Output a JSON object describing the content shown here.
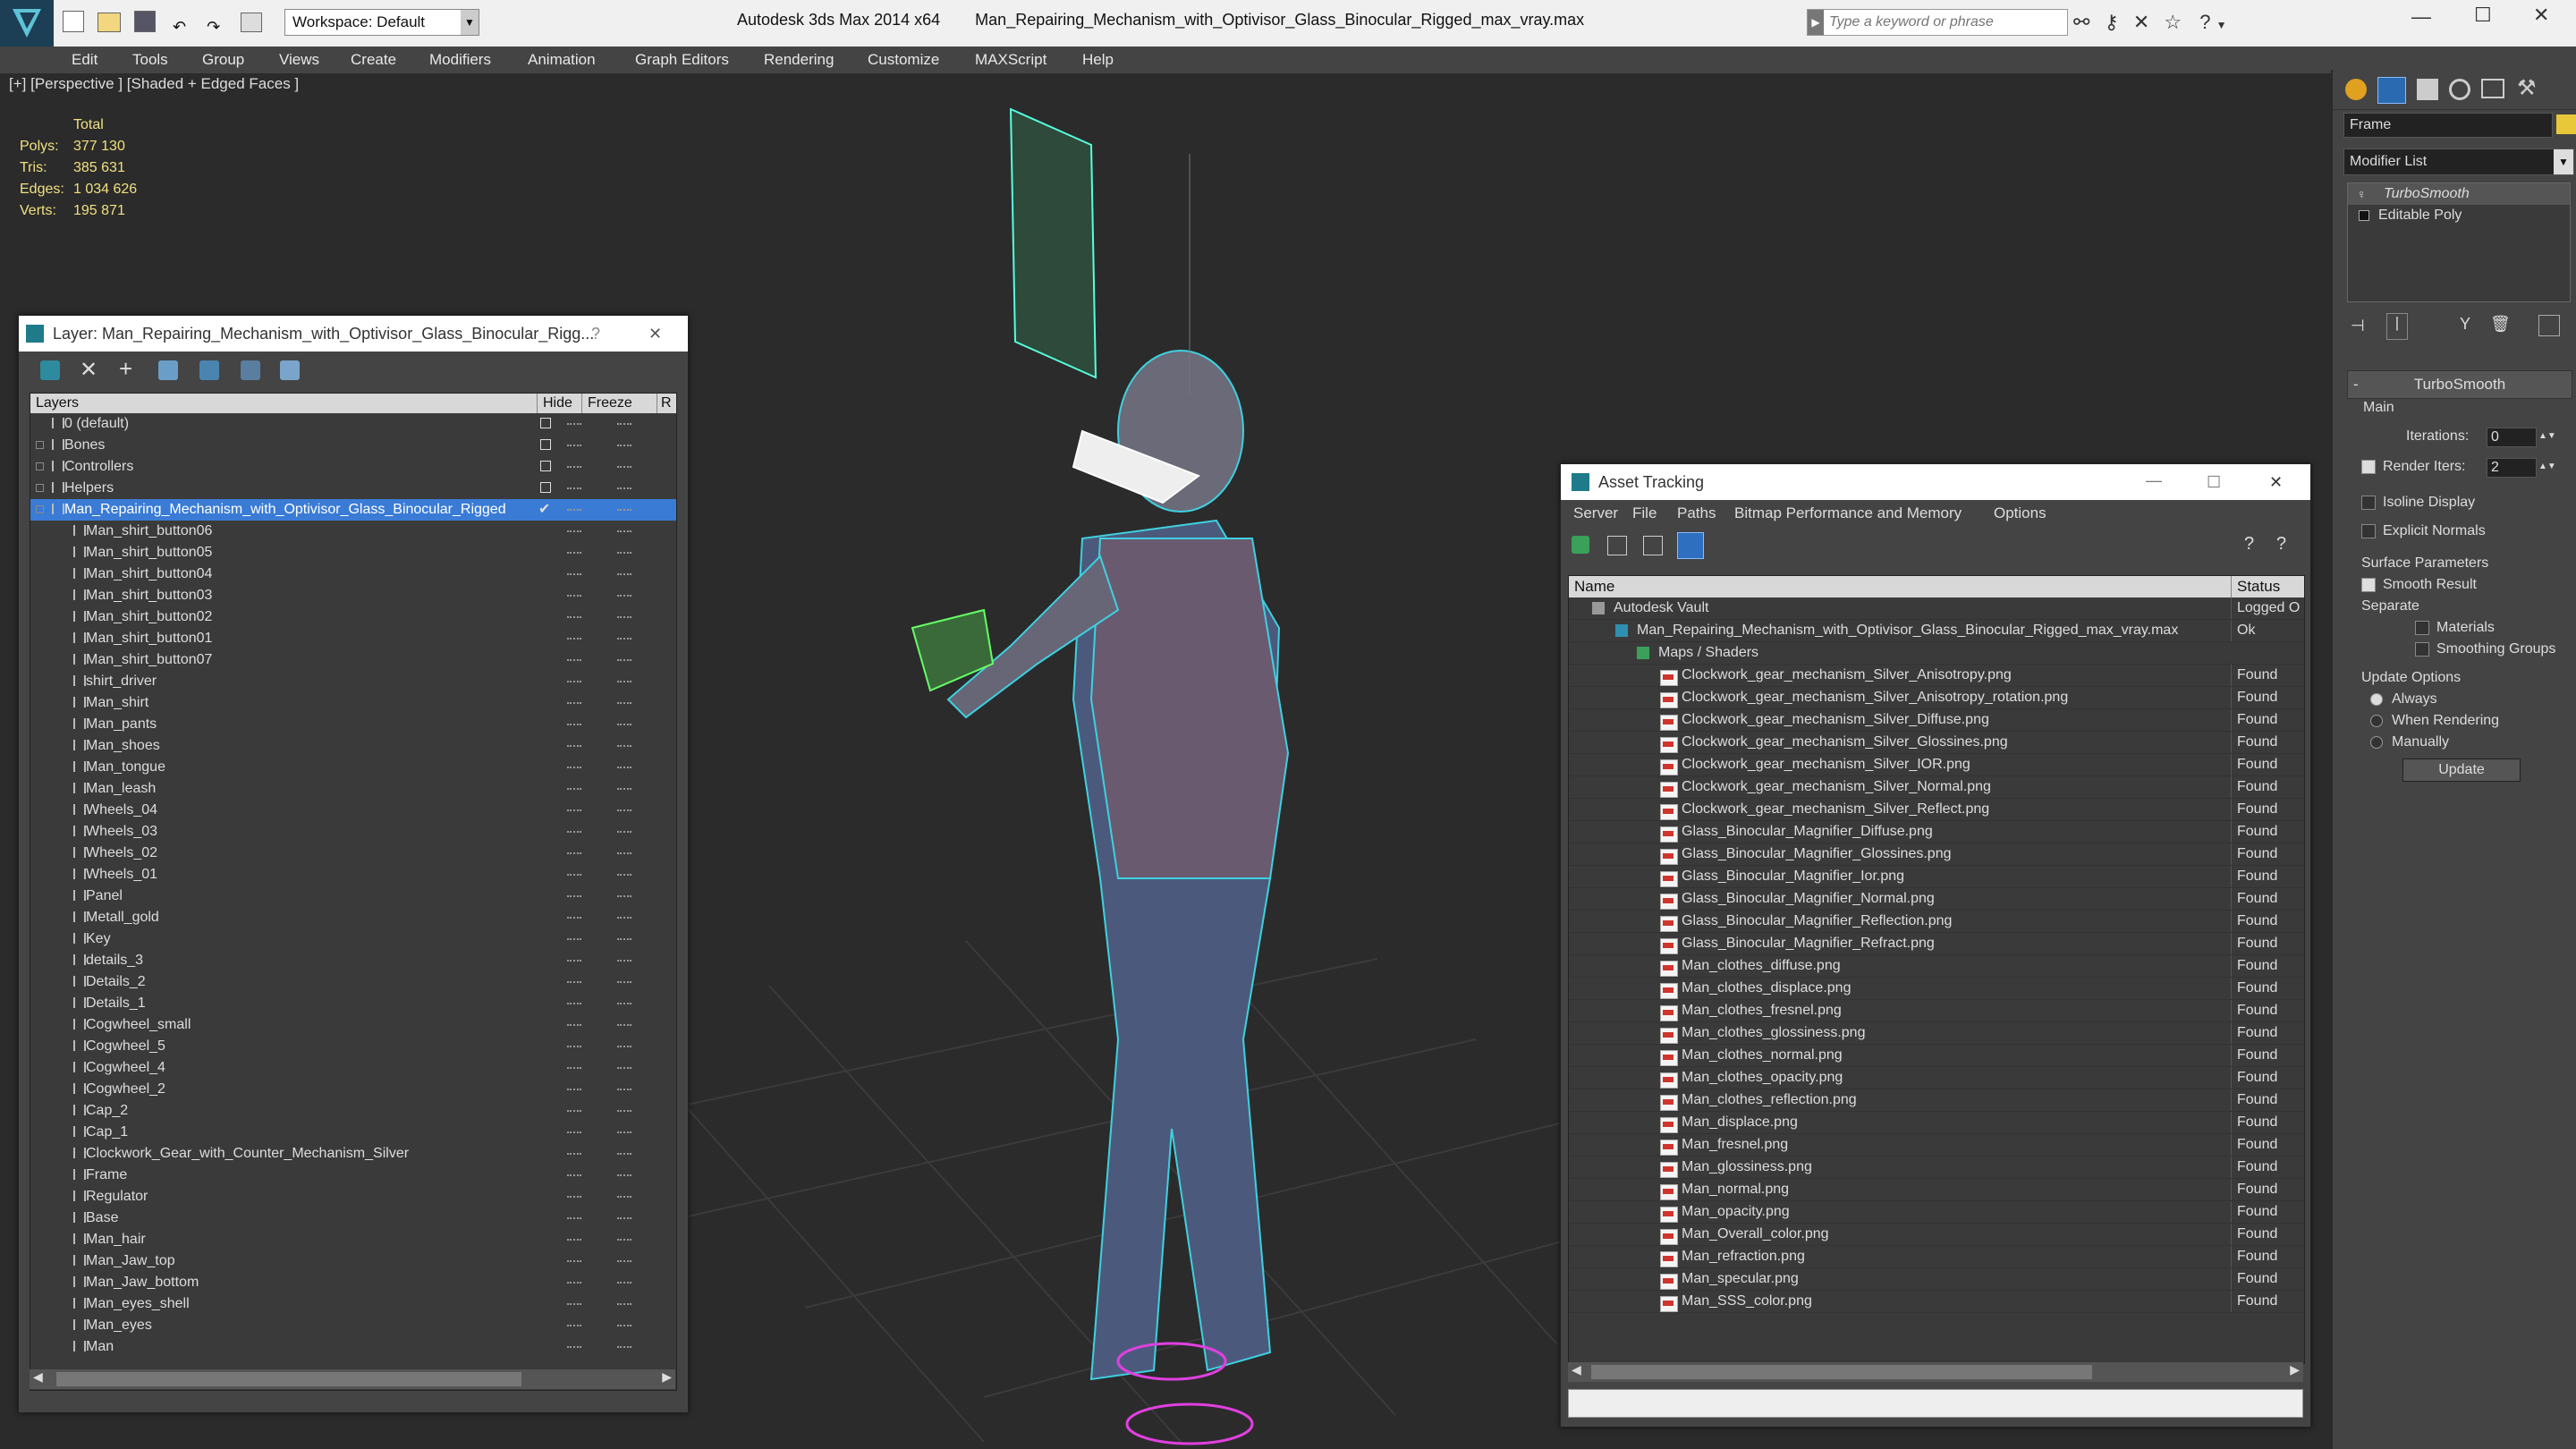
{
  "app": {
    "title": "Autodesk 3ds Max  2014 x64",
    "file": "Man_Repairing_Mechanism_with_Optivisor_Glass_Binocular_Rigged_max_vray.max",
    "workspace": "Workspace: Default",
    "search_placeholder": "Type a keyword or phrase"
  },
  "menu": [
    "Edit",
    "Tools",
    "Group",
    "Views",
    "Create",
    "Modifiers",
    "Animation",
    "Graph Editors",
    "Rendering",
    "Customize",
    "MAXScript",
    "Help"
  ],
  "viewport": {
    "label": "[+] [Perspective ] [Shaded + Edged Faces ]",
    "stats": {
      "total_label": "Total",
      "rows": [
        {
          "label": "Polys:",
          "value": "377 130"
        },
        {
          "label": "Tris:",
          "value": "385 631"
        },
        {
          "label": "Edges:",
          "value": "1 034 626"
        },
        {
          "label": "Verts:",
          "value": "195 871"
        }
      ]
    }
  },
  "layer_window": {
    "title": "Layer: Man_Repairing_Mechanism_with_Optivisor_Glass_Binocular_Rigg...",
    "help": "?",
    "close": "✕",
    "col_layers": "Layers",
    "col_hide": "Hide",
    "col_freeze": "Freeze",
    "col_r": "R",
    "top_layers": [
      "0 (default)",
      "Bones",
      "Controllers",
      "Helpers"
    ],
    "selected_layer": "Man_Repairing_Mechanism_with_Optivisor_Glass_Binocular_Rigged",
    "objects": [
      "Man_shirt_button06",
      "Man_shirt_button05",
      "Man_shirt_button04",
      "Man_shirt_button03",
      "Man_shirt_button02",
      "Man_shirt_button01",
      "Man_shirt_button07",
      "shirt_driver",
      "Man_shirt",
      "Man_pants",
      "Man_shoes",
      "Man_tongue",
      "Man_leash",
      "Wheels_04",
      "Wheels_03",
      "Wheels_02",
      "Wheels_01",
      "Panel",
      "Metall_gold",
      "Key",
      "details_3",
      "Details_2",
      "Details_1",
      "Cogwheel_small",
      "Cogwheel_5",
      "Cogwheel_4",
      "Cogwheel_2",
      "Cap_2",
      "Cap_1",
      "Clockwork_Gear_with_Counter_Mechanism_Silver",
      "Frame",
      "Regulator",
      "Base",
      "Man_hair",
      "Man_Jaw_top",
      "Man_Jaw_bottom",
      "Man_eyes_shell",
      "Man_eyes",
      "Man"
    ]
  },
  "asset_window": {
    "title": "Asset Tracking",
    "menu": [
      "Server",
      "File",
      "Paths",
      "Bitmap Performance and Memory",
      "Options"
    ],
    "col_name": "Name",
    "col_status": "Status",
    "vault": {
      "name": "Autodesk Vault",
      "status": "Logged O"
    },
    "file": {
      "name": "Man_Repairing_Mechanism_with_Optivisor_Glass_Binocular_Rigged_max_vray.max",
      "status": "Ok"
    },
    "group": "Maps / Shaders",
    "maps": [
      {
        "name": "Clockwork_gear_mechanism_Silver_Anisotropy.png",
        "status": "Found"
      },
      {
        "name": "Clockwork_gear_mechanism_Silver_Anisotropy_rotation.png",
        "status": "Found"
      },
      {
        "name": "Clockwork_gear_mechanism_Silver_Diffuse.png",
        "status": "Found"
      },
      {
        "name": "Clockwork_gear_mechanism_Silver_Glossines.png",
        "status": "Found"
      },
      {
        "name": "Clockwork_gear_mechanism_Silver_IOR.png",
        "status": "Found"
      },
      {
        "name": "Clockwork_gear_mechanism_Silver_Normal.png",
        "status": "Found"
      },
      {
        "name": "Clockwork_gear_mechanism_Silver_Reflect.png",
        "status": "Found"
      },
      {
        "name": "Glass_Binocular_Magnifier_Diffuse.png",
        "status": "Found"
      },
      {
        "name": "Glass_Binocular_Magnifier_Glossines.png",
        "status": "Found"
      },
      {
        "name": "Glass_Binocular_Magnifier_Ior.png",
        "status": "Found"
      },
      {
        "name": "Glass_Binocular_Magnifier_Normal.png",
        "status": "Found"
      },
      {
        "name": "Glass_Binocular_Magnifier_Reflection.png",
        "status": "Found"
      },
      {
        "name": "Glass_Binocular_Magnifier_Refract.png",
        "status": "Found"
      },
      {
        "name": "Man_clothes_diffuse.png",
        "status": "Found"
      },
      {
        "name": "Man_clothes_displace.png",
        "status": "Found"
      },
      {
        "name": "Man_clothes_fresnel.png",
        "status": "Found"
      },
      {
        "name": "Man_clothes_glossiness.png",
        "status": "Found"
      },
      {
        "name": "Man_clothes_normal.png",
        "status": "Found"
      },
      {
        "name": "Man_clothes_opacity.png",
        "status": "Found"
      },
      {
        "name": "Man_clothes_reflection.png",
        "status": "Found"
      },
      {
        "name": "Man_displace.png",
        "status": "Found"
      },
      {
        "name": "Man_fresnel.png",
        "status": "Found"
      },
      {
        "name": "Man_glossiness.png",
        "status": "Found"
      },
      {
        "name": "Man_normal.png",
        "status": "Found"
      },
      {
        "name": "Man_opacity.png",
        "status": "Found"
      },
      {
        "name": "Man_Overall_color.png",
        "status": "Found"
      },
      {
        "name": "Man_refraction.png",
        "status": "Found"
      },
      {
        "name": "Man_specular.png",
        "status": "Found"
      },
      {
        "name": "Man_SSS_color.png",
        "status": "Found"
      }
    ]
  },
  "command_panel": {
    "object_name": "Frame",
    "modifier_list": "Modifier List",
    "stack": [
      "TurboSmooth",
      "Editable Poly"
    ],
    "rollout_title": "TurboSmooth",
    "main_label": "Main",
    "iterations_label": "Iterations:",
    "iterations_value": "0",
    "render_iters_label": "Render Iters:",
    "render_iters_value": "2",
    "isoline": "Isoline Display",
    "explicit_normals": "Explicit Normals",
    "surface_params": "Surface Parameters",
    "smooth_result": "Smooth Result",
    "separate": "Separate",
    "materials": "Materials",
    "smoothing_groups": "Smoothing Groups",
    "update_options": "Update Options",
    "always": "Always",
    "when_rendering": "When Rendering",
    "manually": "Manually",
    "update_btn": "Update"
  },
  "colors": {
    "accent_select": "#3a7bd5",
    "stats_yellow": "#f0e080",
    "wire_cyan": "#3fd0e0"
  }
}
